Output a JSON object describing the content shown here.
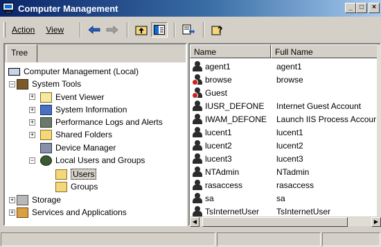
{
  "window": {
    "title": "Computer Management"
  },
  "title_buttons": [
    "_",
    "□",
    "×"
  ],
  "menu": {
    "action": "Action",
    "view": "View"
  },
  "toolbar_icons": [
    "back-arrow",
    "forward-arrow",
    "up-level",
    "show-hide-tree",
    "export-list",
    "help"
  ],
  "tree_tab": "Tree",
  "tree": {
    "root": "Computer Management (Local)",
    "system_tools": "System Tools",
    "event_viewer": "Event Viewer",
    "system_information": "System Information",
    "performance_logs": "Performance Logs and Alerts",
    "shared_folders": "Shared Folders",
    "device_manager": "Device Manager",
    "local_users_groups": "Local Users and Groups",
    "users": "Users",
    "groups": "Groups",
    "storage": "Storage",
    "services": "Services and Applications"
  },
  "list": {
    "columns": [
      "Name",
      "Full Name"
    ],
    "rows": [
      {
        "name": "agent1",
        "full": "agent1",
        "disabled": false
      },
      {
        "name": "browse",
        "full": "browse",
        "disabled": true
      },
      {
        "name": "Guest",
        "full": "",
        "disabled": true
      },
      {
        "name": "IUSR_DEFONE",
        "full": "Internet Guest Account",
        "disabled": false
      },
      {
        "name": "IWAM_DEFONE",
        "full": "Launch IIS Process Accour",
        "disabled": false
      },
      {
        "name": "lucent1",
        "full": "lucent1",
        "disabled": false
      },
      {
        "name": "lucent2",
        "full": "lucent2",
        "disabled": false
      },
      {
        "name": "lucent3",
        "full": "lucent3",
        "disabled": false
      },
      {
        "name": "NTAdmin",
        "full": "NTadmin",
        "disabled": false
      },
      {
        "name": "rasaccess",
        "full": "rasaccess",
        "disabled": false
      },
      {
        "name": "sa",
        "full": "sa",
        "disabled": false
      },
      {
        "name": "TsInternetUser",
        "full": "TsInternetUser",
        "disabled": false
      }
    ]
  }
}
